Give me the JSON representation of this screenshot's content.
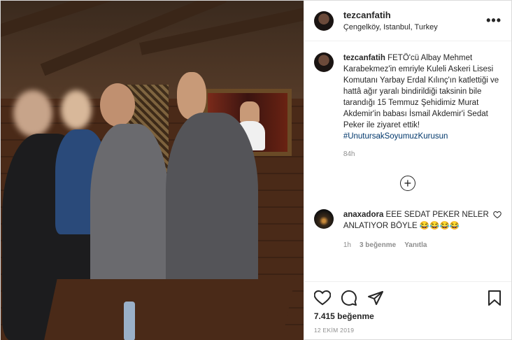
{
  "post": {
    "username": "tezcanfatih",
    "location": "Çengelköy, Istanbul, Turkey",
    "more_label": "•••",
    "caption": {
      "username": "tezcanfatih",
      "text": "FETÖ'cü Albay Mehmet Karabekmez'in emriyle Kuleli Askeri Lisesi Komutanı Yarbay Erdal Kılınç'ın katlettiği ve hattâ ağır yaralı bindirildiği taksinin bile tarandığı 15 Temmuz Şehidimiz Murat Akdemir'in babası İsmail Akdemir'i Sedat Peker ile ziyaret ettik!",
      "hashtag": "#UnutursakSoyumuzKurusun",
      "age": "84h"
    },
    "load_more_label": "+",
    "comment": {
      "username": "anaxadora",
      "text": "EEE SEDAT PEKER NELER ANLATIYOR BÖYLE 😂😂😂😂",
      "age": "1h",
      "likes": "3 beğenme",
      "reply": "Yanıtla"
    },
    "likes": "7.415 beğenme",
    "date": "12 EKİM 2019"
  },
  "icons": {
    "like": "heart-icon",
    "comment": "comment-icon",
    "share": "share-icon",
    "save": "bookmark-icon",
    "comment_like": "heart-icon"
  }
}
